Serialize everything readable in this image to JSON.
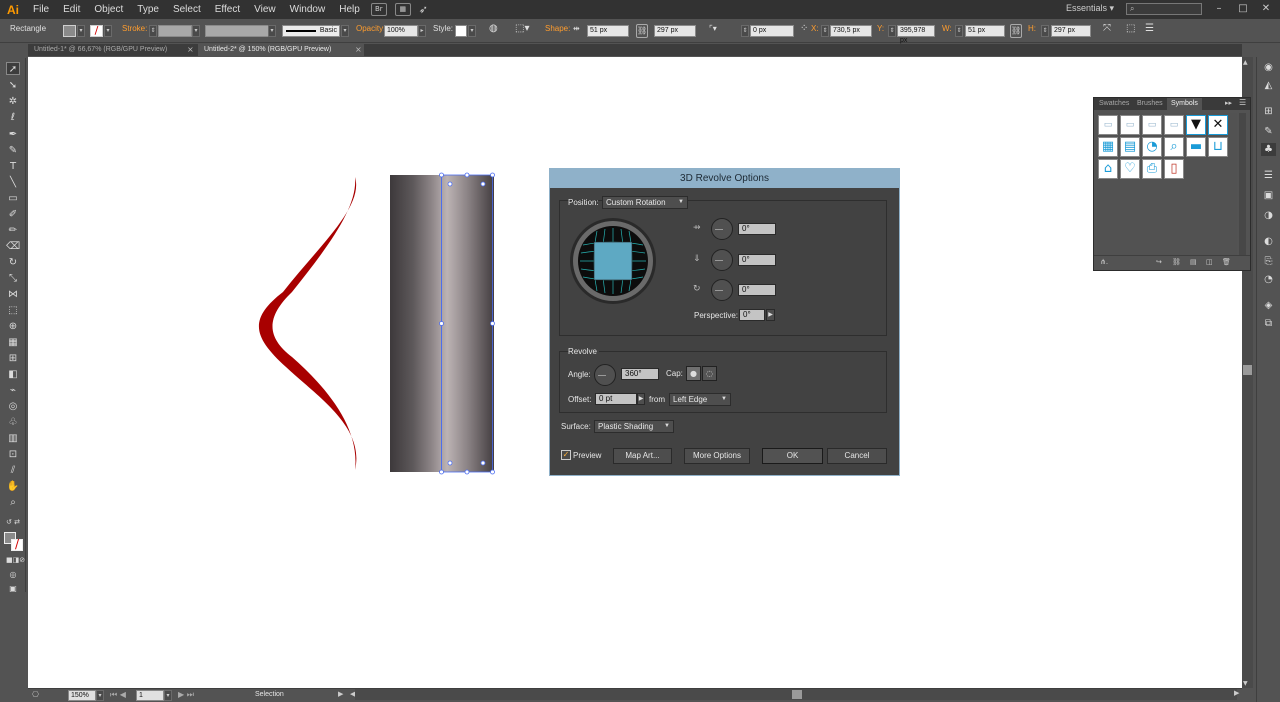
{
  "app": {
    "logo": "Ai"
  },
  "menu": [
    "File",
    "Edit",
    "Object",
    "Type",
    "Select",
    "Effect",
    "View",
    "Window",
    "Help"
  ],
  "menubar_icons": {
    "bridge": "Br"
  },
  "workspace": {
    "label": "Essentials"
  },
  "control": {
    "tool_name": "Rectangle",
    "stroke_label": "Stroke:",
    "brush_label": "Basic",
    "opacity_label": "Opacity:",
    "opacity_value": "100%",
    "style_label": "Style:",
    "shape_label": "Shape:",
    "shape_w": "51 px",
    "shape_h": "297 px",
    "corner": "0 px",
    "x_label": "X:",
    "x_value": "730,5 px",
    "y_label": "Y:",
    "y_value": "395,978 px",
    "w_label": "W:",
    "w_value": "51 px",
    "h_label": "H:",
    "h_value": "297 px"
  },
  "tabs": [
    {
      "label": "Untitled-1* @ 66,67% (RGB/GPU Preview)",
      "active": false
    },
    {
      "label": "Untitled-2* @ 150% (RGB/GPU Preview)",
      "active": true
    }
  ],
  "status": {
    "zoom": "150%",
    "artboard": "1",
    "mode": "Selection"
  },
  "symbols_panel": {
    "tabs": [
      "Swatches",
      "Brushes",
      "Symbols"
    ],
    "active_tab": "Symbols",
    "icons": [
      "button-icon",
      "button-icon",
      "button-icon",
      "button-icon",
      "dropdown-icon",
      "close-icon",
      "calendar-icon",
      "film-icon",
      "rss-icon",
      "search-icon",
      "bar-icon",
      "cart-icon",
      "home-icon",
      "heart-add-icon",
      "printer-icon",
      "column-icon"
    ]
  },
  "dialog": {
    "title": "3D Revolve Options",
    "position_label": "Position:",
    "position_value": "Custom Rotation",
    "rot_x": "0°",
    "rot_y": "0°",
    "rot_z": "0°",
    "perspective_label": "Perspective:",
    "perspective_value": "0°",
    "revolve_label": "Revolve",
    "angle_label": "Angle:",
    "angle_value": "360°",
    "cap_label": "Cap:",
    "offset_label": "Offset:",
    "offset_value": "0 pt",
    "from_label": "from",
    "from_value": "Left Edge",
    "surface_label": "Surface:",
    "surface_value": "Plastic Shading",
    "preview_label": "Preview",
    "preview_checked": true,
    "map_art": "Map Art...",
    "more_options": "More Options",
    "ok": "OK",
    "cancel": "Cancel"
  },
  "colors": {
    "curve": "#a80000",
    "dialog_title": "#8fb1c9",
    "cube": "#5ea9c3",
    "selection": "#4a6cf0",
    "ui_accent": "#ff9d2e"
  }
}
